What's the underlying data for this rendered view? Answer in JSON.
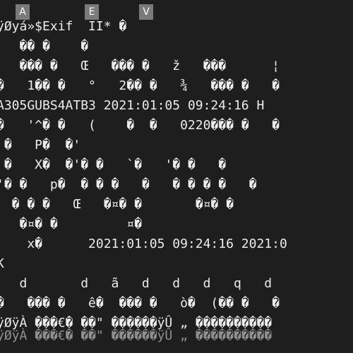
{
  "tabs": {
    "a": "A",
    "e": "E",
    "v": "V"
  },
  "terminal": {
    "lines": [
      "ÿØyá»$Exif  II* �",
      "   �� �    �",
      "   ��� �   Œ   ��� �   ž   ���      ¦",
      "�   1�� �   °   2�� �   ¾   ��� �   �",
      "A305GUBS4ATB3 2021:01:05 09:24:16 H",
      "�   '^� �   (    �  �   0220��� �   �",
      " �   P�  �'",
      " �   X�  �'� �   `�   '� �   �",
      "'� �   p�  � � �   �   � � � �   �",
      "  � � �   Œ   �¤� �       �¤� �",
      "   �¤� �         ¤�",
      "    x�      2021:01:05 09:24:16 2021:0",
      "K",
      "   d       d   ã   d   d   d   q   d",
      "�   ��� �   ê�  ��� �   ò�  (�� �   �",
      "ÿØÿÀ ���€� ��\" ������ÿÛ „ ����������",
      "ÿØÿÀ ���€� ��\" ������ÿÛ „ ����������"
    ]
  },
  "colors": {
    "background": "#1e1e1e",
    "text": "#ececec",
    "tab": "#7a7a7a"
  }
}
